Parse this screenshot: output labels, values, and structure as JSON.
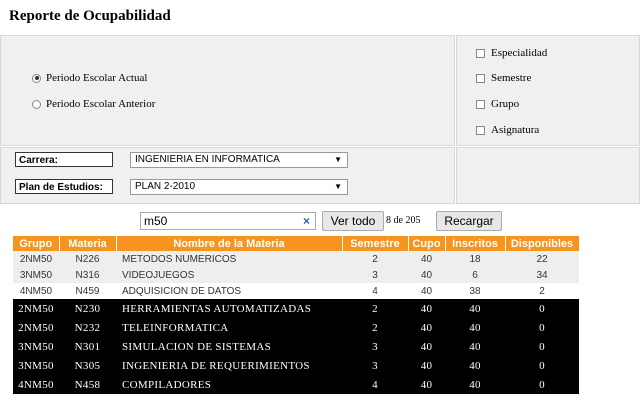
{
  "page_title": "Reporte de Ocupabilidad",
  "periodo": {
    "options": [
      {
        "label": "Periodo Escolar Actual",
        "selected": true
      },
      {
        "label": "Periodo Escolar Anterior",
        "selected": false
      }
    ]
  },
  "filters": {
    "checkboxes": [
      "Especialidad",
      "Semestre",
      "Grupo",
      "Asignatura"
    ]
  },
  "carrera": {
    "label": "Carrera:",
    "value": "INGENIERIA EN INFORMATICA"
  },
  "plan": {
    "label": "Plan de Estudios:",
    "value": "PLAN 2-2010"
  },
  "search": {
    "value": "m50",
    "clear_icon": "×"
  },
  "buttons": {
    "ver_todo": "Ver todo",
    "recargar": "Recargar"
  },
  "record_count": "8 de 205",
  "table": {
    "headers": [
      "Grupo",
      "Materia",
      "Nombre de la Materia",
      "Semestre",
      "Cupo",
      "Inscritos",
      "Disponibles"
    ],
    "rows": [
      {
        "grupo": "2NM50",
        "materia": "N226",
        "nombre": "METODOS NUMERICOS",
        "semestre": "2",
        "cupo": "40",
        "inscritos": "18",
        "disponibles": "22"
      },
      {
        "grupo": "3NM50",
        "materia": "N316",
        "nombre": "VIDEOJUEGOS",
        "semestre": "3",
        "cupo": "40",
        "inscritos": "6",
        "disponibles": "34"
      },
      {
        "grupo": "4NM50",
        "materia": "N459",
        "nombre": "ADQUISICION DE DATOS",
        "semestre": "4",
        "cupo": "40",
        "inscritos": "38",
        "disponibles": "2"
      },
      {
        "grupo": "2NM50",
        "materia": "N230",
        "nombre": "HERRAMIENTAS AUTOMATIZADAS",
        "semestre": "2",
        "cupo": "40",
        "inscritos": "40",
        "disponibles": "0"
      },
      {
        "grupo": "2NM50",
        "materia": "N232",
        "nombre": "TELEINFORMATICA",
        "semestre": "2",
        "cupo": "40",
        "inscritos": "40",
        "disponibles": "0"
      },
      {
        "grupo": "3NM50",
        "materia": "N301",
        "nombre": "SIMULACION DE SISTEMAS",
        "semestre": "3",
        "cupo": "40",
        "inscritos": "40",
        "disponibles": "0"
      },
      {
        "grupo": "3NM50",
        "materia": "N305",
        "nombre": "INGENIERIA DE REQUERIMIENTOS",
        "semestre": "3",
        "cupo": "40",
        "inscritos": "40",
        "disponibles": "0"
      },
      {
        "grupo": "4NM50",
        "materia": "N458",
        "nombre": "COMPILADORES",
        "semestre": "4",
        "cupo": "40",
        "inscritos": "40",
        "disponibles": "0"
      }
    ]
  },
  "colors": {
    "header": "#f7941d",
    "full_row": "#000000",
    "clear_icon": "#2a5ab8"
  }
}
